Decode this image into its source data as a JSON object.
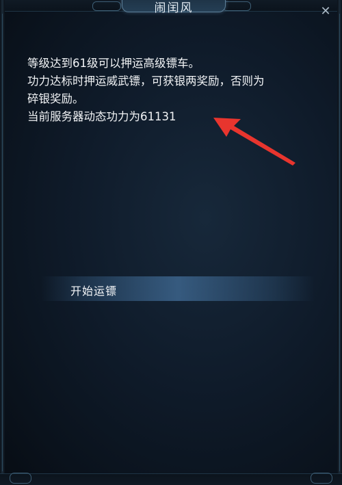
{
  "dialog": {
    "title": "闹闰风"
  },
  "description": {
    "line1": "等级达到61级可以押运高级镖车。",
    "line2": "功力达标时押运威武镖，可获银两奖励，否则为",
    "line3": "碎银奖励。",
    "line4": "当前服务器动态功力为61131"
  },
  "actions": {
    "start_escort": "开始运镖"
  },
  "icons": {
    "close": "close-icon",
    "annotation_arrow": "red-arrow-icon"
  },
  "colors": {
    "accent_arrow": "#e8352e",
    "panel_bg": "#0f1b2a",
    "action_highlight": "#3c648c"
  }
}
